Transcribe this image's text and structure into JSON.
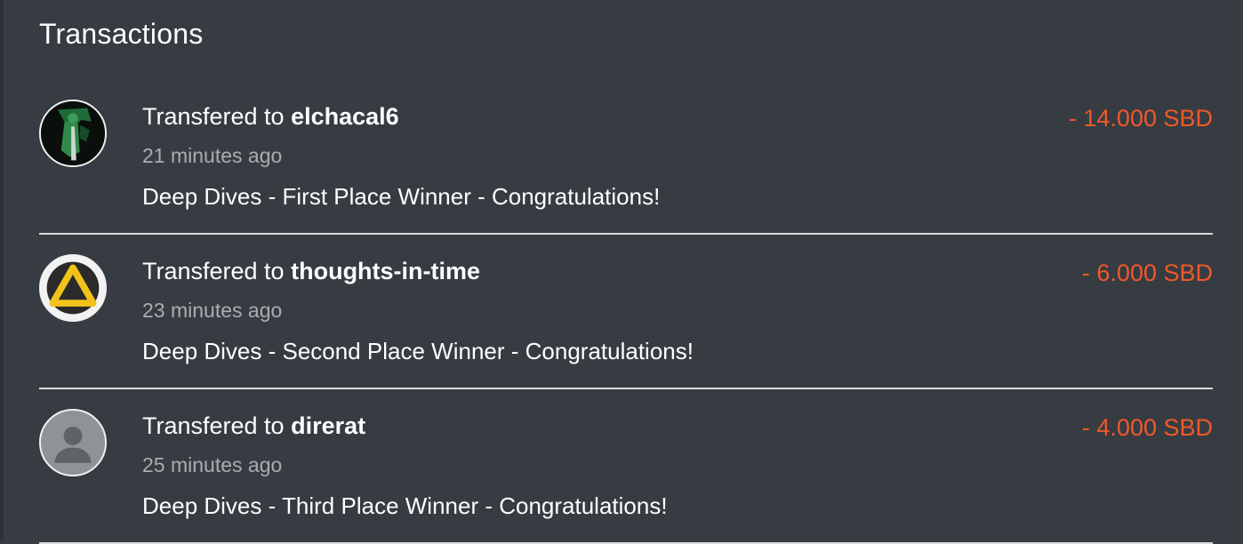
{
  "title": "Transactions",
  "accent_negative": "#f0582b",
  "transactions": [
    {
      "prefix": "Transfered to",
      "user": "elchacal6",
      "time": "21 minutes ago",
      "memo": "Deep Dives - First Place Winner - Congratulations!",
      "amount": "- 14.000 SBD",
      "avatar_icon": "avatar-green-figure-icon"
    },
    {
      "prefix": "Transfered to",
      "user": "thoughts-in-time",
      "time": "23 minutes ago",
      "memo": "Deep Dives - Second Place Winner - Congratulations!",
      "amount": "- 6.000 SBD",
      "avatar_icon": "avatar-yellow-triangle-logo-icon"
    },
    {
      "prefix": "Transfered to",
      "user": "direrat",
      "time": "25 minutes ago",
      "memo": "Deep Dives - Third Place Winner - Congratulations!",
      "amount": "- 4.000 SBD",
      "avatar_icon": "avatar-default-user-icon"
    }
  ]
}
